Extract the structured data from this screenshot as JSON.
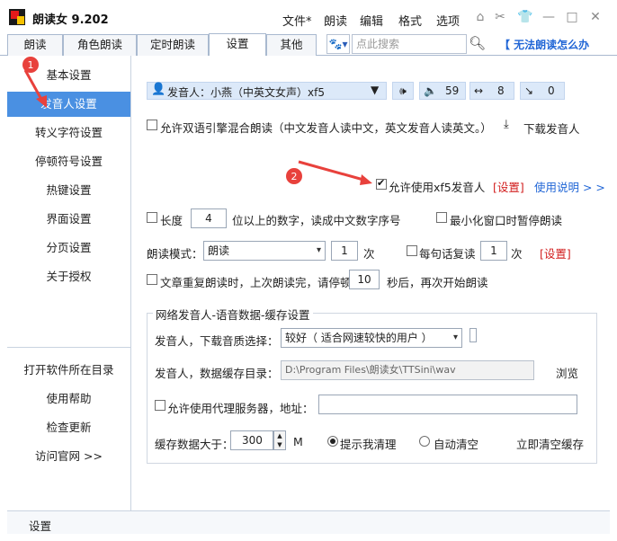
{
  "app": {
    "title": "朗读女 9.202"
  },
  "menu": [
    "文件*",
    "朗读",
    "编辑",
    "格式",
    "选项"
  ],
  "tabs": [
    {
      "label": "朗读"
    },
    {
      "label": "角色朗读"
    },
    {
      "label": "定时朗读"
    },
    {
      "label": "设置",
      "active": true
    },
    {
      "label": "其他"
    }
  ],
  "search": {
    "placeholder": "点此搜索"
  },
  "help_link": "【 无法朗读怎么办",
  "nav": {
    "items": [
      "基本设置",
      "发音人设置",
      "转义字符设置",
      "停顿符号设置",
      "热键设置",
      "界面设置",
      "分页设置",
      "关于授权"
    ],
    "active_index": 1,
    "bottom": [
      "打开软件所在目录",
      "使用帮助",
      "检查更新",
      "访问官网 >>"
    ]
  },
  "status": "设置",
  "speaker": {
    "label": "发音人：小燕（中英文女声）xf5",
    "speed": "59",
    "width": "8",
    "pitch": "0"
  },
  "settings": {
    "dual_engine": "允许双语引擎混合朗读（中文发音人读中文，英文发音人读英文。）",
    "download_speaker": "下载发音人",
    "allow_xf5": "允许使用xf5发音人",
    "xf5_settings": "[设置]",
    "xf5_help": "使用说明 > >",
    "length_label": "长度",
    "length_value": "4",
    "length_suffix": "位以上的数字，读成中文数字序号",
    "minimize_pause": "最小化窗口时暂停朗读",
    "read_mode_label": "朗读模式：",
    "read_mode_value": "朗读",
    "read_times": "1",
    "times_unit": "次",
    "repeat_sentence": "每句话复读",
    "repeat_value": "1",
    "repeat_unit": "次",
    "repeat_settings": "[设置]",
    "article_repeat": "文章重复朗读时，上次朗读完，请停顿",
    "pause_seconds": "10",
    "pause_suffix": "秒后，再次开始朗读"
  },
  "network": {
    "title": "网络发音人-语音数据-缓存设置",
    "quality_label": "发音人，下载音质选择：",
    "quality_value": "较好（ 适合网速较快的用户 ）",
    "cache_dir_label": "发音人，数据缓存目录：",
    "cache_dir_value": "D:\\Program Files\\朗读女\\TTSini\\wav",
    "browse": "浏览",
    "proxy_label": "允许使用代理服务器，地址：",
    "cache_size_label": "缓存数据大于：",
    "cache_size_value": "300",
    "cache_unit": "M",
    "remind_clear": "提示我清理",
    "auto_clear": "自动清空",
    "clear_now": "立即清空缓存"
  },
  "annotations": [
    "1",
    "2"
  ],
  "colors": {
    "accent": "#4a90e2",
    "annotation": "#e8413c",
    "link": "#2166d6",
    "warn": "#d21e1e"
  }
}
